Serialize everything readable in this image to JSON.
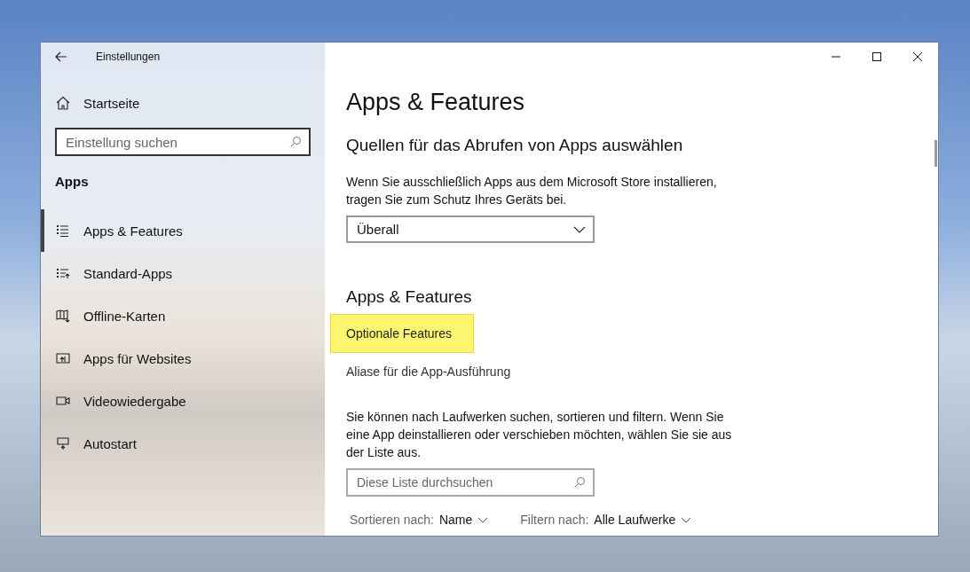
{
  "window": {
    "title": "Einstellungen"
  },
  "sidebar": {
    "home": "Startseite",
    "search": {
      "placeholder": "Einstellung suchen"
    },
    "section": "Apps",
    "items": [
      {
        "label": "Apps & Features",
        "kind": "list",
        "selected": true
      },
      {
        "label": "Standard-Apps",
        "kind": "defaults",
        "selected": false
      },
      {
        "label": "Offline-Karten",
        "kind": "map",
        "selected": false
      },
      {
        "label": "Apps für Websites",
        "kind": "web",
        "selected": false
      },
      {
        "label": "Videowiedergabe",
        "kind": "video",
        "selected": false
      },
      {
        "label": "Autostart",
        "kind": "startup",
        "selected": false
      }
    ]
  },
  "content": {
    "title": "Apps & Features",
    "sources": {
      "heading": "Quellen für das Abrufen von Apps auswählen",
      "text": "Wenn Sie ausschließlich Apps aus dem Microsoft Store installieren, tragen Sie zum Schutz Ihres Geräts bei.",
      "dropdown": "Überall"
    },
    "section": {
      "heading": "Apps & Features",
      "links": [
        {
          "label": "Optionale Features",
          "highlighted": true
        },
        {
          "label": "Aliase für die App-Ausführung",
          "highlighted": false
        }
      ],
      "text": "Sie können nach Laufwerken suchen, sortieren und filtern. Wenn Sie eine App deinstallieren oder verschieben möchten, wählen Sie sie aus der Liste aus.",
      "search": {
        "placeholder": "Diese Liste durchsuchen"
      },
      "sort": {
        "label": "Sortieren nach:",
        "value": "Name"
      },
      "filter": {
        "label": "Filtern nach:",
        "value": "Alle Laufwerke"
      }
    }
  }
}
